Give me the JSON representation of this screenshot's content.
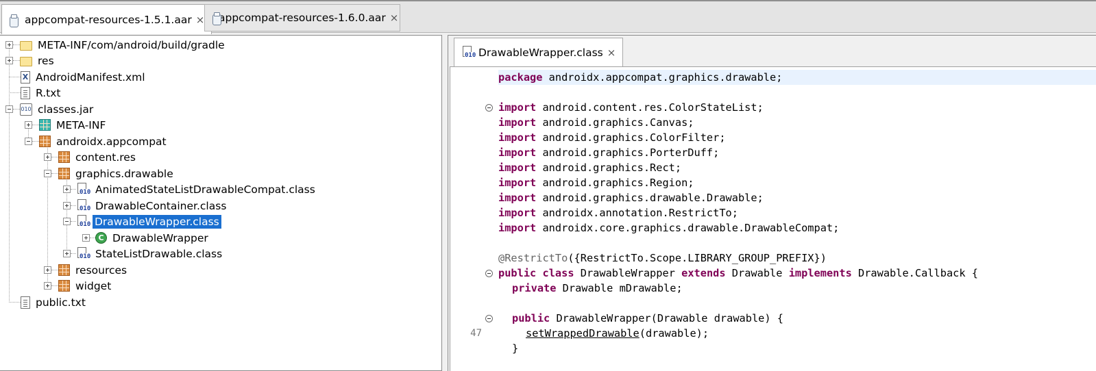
{
  "top_tabs": [
    {
      "label": "appcompat-resources-1.5.1.aar"
    },
    {
      "label": "appcompat-resources-1.6.0.aar"
    }
  ],
  "tree": {
    "items": [
      {
        "label": "META-INF/com/android/build/gradle",
        "icon": "folder-icon"
      },
      {
        "label": "res",
        "icon": "folder-icon"
      },
      {
        "label": "AndroidManifest.xml",
        "icon": "xml-file-icon"
      },
      {
        "label": "R.txt",
        "icon": "text-file-icon"
      },
      {
        "label": "classes.jar",
        "icon": "jar-file-icon"
      },
      {
        "label": "META-INF",
        "icon": "package-icon"
      },
      {
        "label": "androidx.appcompat",
        "icon": "package-icon"
      },
      {
        "label": "content.res",
        "icon": "package-icon"
      },
      {
        "label": "graphics.drawable",
        "icon": "package-icon"
      },
      {
        "label": "AnimatedStateListDrawableCompat.class",
        "icon": "class-file-icon"
      },
      {
        "label": "DrawableContainer.class",
        "icon": "class-file-icon"
      },
      {
        "label": "DrawableWrapper.class",
        "icon": "class-file-icon"
      },
      {
        "label": "DrawableWrapper",
        "icon": "class-icon"
      },
      {
        "label": "StateListDrawable.class",
        "icon": "class-file-icon"
      },
      {
        "label": "resources",
        "icon": "package-icon"
      },
      {
        "label": "widget",
        "icon": "package-icon"
      },
      {
        "label": "public.txt",
        "icon": "text-file-icon"
      }
    ],
    "selected": "DrawableWrapper.class"
  },
  "editor": {
    "tab_label": "DrawableWrapper.class",
    "line_number": "47",
    "code": {
      "l1_kw": "package",
      "l1_rest": " androidx.appcompat.graphics.drawable;",
      "imp_kw": "import",
      "imports": [
        " android.content.res.ColorStateList;",
        " android.graphics.Canvas;",
        " android.graphics.ColorFilter;",
        " android.graphics.PorterDuff;",
        " android.graphics.Rect;",
        " android.graphics.Region;",
        " android.graphics.drawable.Drawable;",
        " androidx.annotation.RestrictTo;",
        " androidx.core.graphics.drawable.DrawableCompat;"
      ],
      "annotation": "@RestrictTo",
      "annotation_rest": "({RestrictTo.Scope.LIBRARY_GROUP_PREFIX})",
      "public_kw": "public",
      "class_kw": "class",
      "class_name": " DrawableWrapper ",
      "extends_kw": "extends",
      "extends_name": " Drawable ",
      "implements_kw": "implements",
      "implements_name": " Drawable.Callback {",
      "private_kw": "private",
      "field_rest": " Drawable mDrawable;",
      "ctor_kw": "public",
      "ctor_rest": " DrawableWrapper(Drawable drawable) {",
      "call_name": "setWrappedDrawable",
      "call_rest": "(drawable);",
      "close_brace": "}"
    }
  }
}
